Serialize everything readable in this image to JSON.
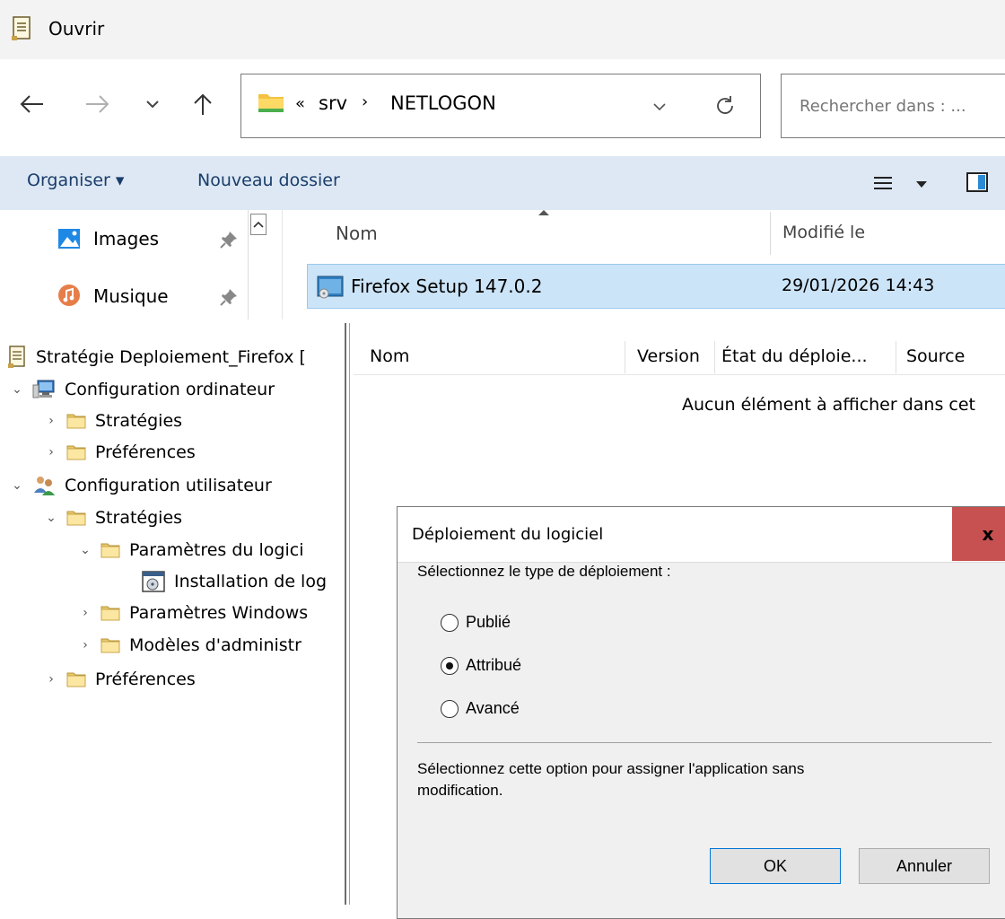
{
  "open_dialog": {
    "title": "Ouvrir",
    "address": {
      "overflow": "«",
      "crumbs": [
        "srv",
        "NETLOGON"
      ],
      "separator": "›"
    },
    "search_placeholder": "Rechercher dans : ...",
    "toolbar": {
      "organize": "Organiser ▾",
      "new_folder": "Nouveau dossier"
    },
    "nav_items": [
      "Images",
      "Musique"
    ],
    "columns": {
      "name": "Nom",
      "modified": "Modifié le"
    },
    "files": [
      {
        "name": "Firefox Setup 147.0.2",
        "modified": "29/01/2026 14:43"
      }
    ],
    "icons": [
      "back-arrow-icon",
      "forward-arrow-icon",
      "recent-dropdown-icon",
      "up-arrow-icon",
      "folder-icon",
      "refresh-icon",
      "pin-icon",
      "view-icon",
      "preview-pane-icon"
    ]
  },
  "gpo_editor": {
    "root": "Stratégie Deploiement_Firefox [",
    "tree": {
      "computer_config": "Configuration ordinateur",
      "computer_policies": "Stratégies",
      "computer_prefs": "Préférences",
      "user_config": "Configuration utilisateur",
      "user_policies": "Stratégies",
      "software_settings": "Paramètres du logici",
      "software_install": "Installation de log",
      "windows_settings": "Paramètres Windows",
      "admin_templates": "Modèles d'administr",
      "user_prefs": "Préférences"
    },
    "columns": {
      "name": "Nom",
      "version": "Version",
      "deploy_state": "État du déploie...",
      "source": "Source"
    },
    "empty_message": "Aucun élément à afficher dans cet"
  },
  "deploy_dialog": {
    "title": "Déploiement du logiciel",
    "close": "x",
    "prompt": "Sélectionnez le type de déploiement :",
    "options": [
      {
        "label": "Publié",
        "checked": false
      },
      {
        "label": "Attribué",
        "checked": true
      },
      {
        "label": "Avancé",
        "checked": false
      }
    ],
    "description_line1": "Sélectionnez cette option pour assigner l'application sans",
    "description_line2": "modification.",
    "ok": "OK",
    "cancel": "Annuler"
  },
  "colors": {
    "accent": "#0078d7",
    "selection": "#cce4f7",
    "command_bar": "#dde8f4",
    "close_button": "#c75050"
  }
}
